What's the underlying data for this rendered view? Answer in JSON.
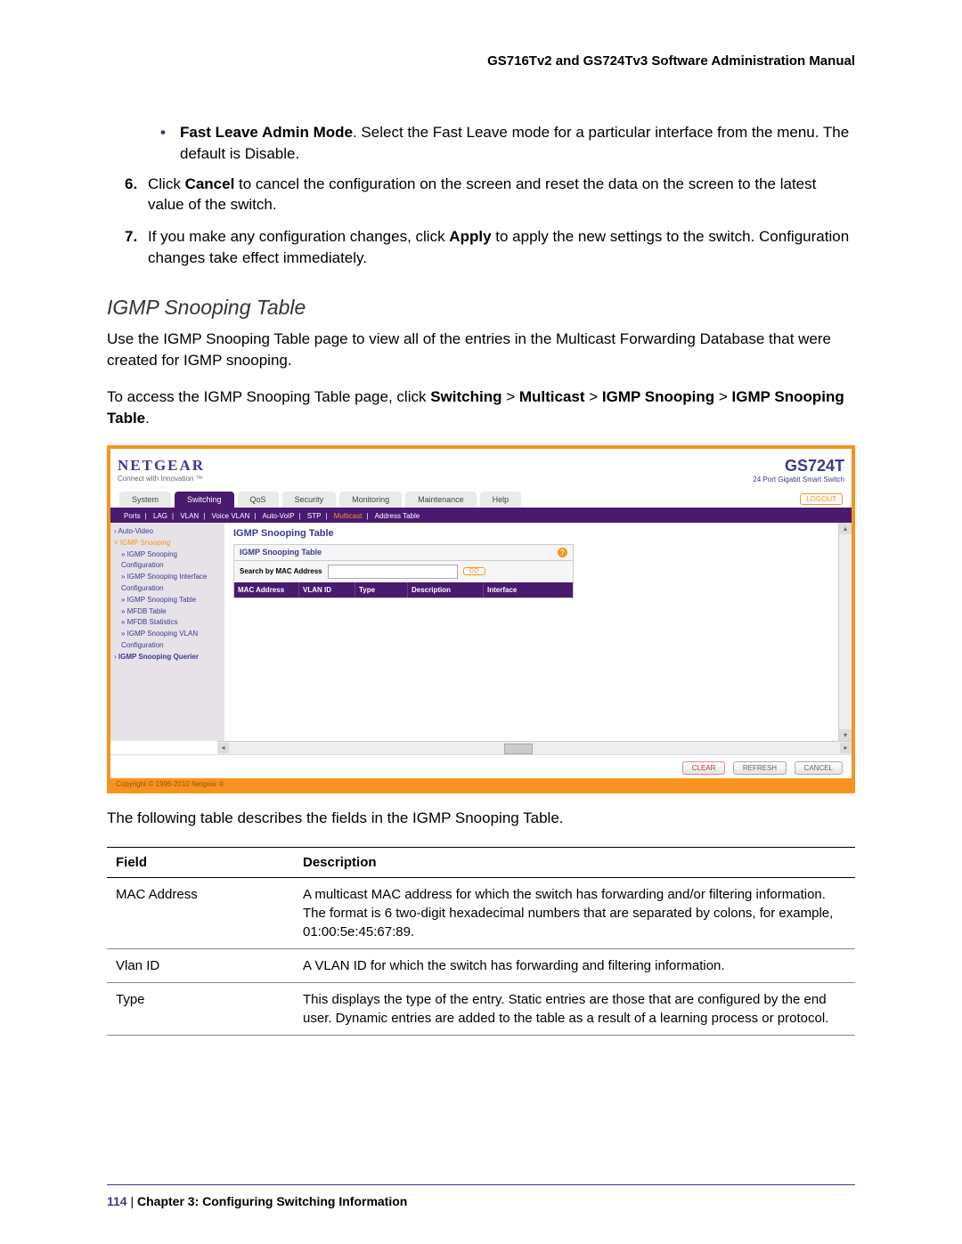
{
  "header": {
    "title": "GS716Tv2 and GS724Tv3 Software Administration Manual"
  },
  "bullet": {
    "label": "Fast Leave Admin Mode",
    "text": ". Select the Fast Leave mode for a particular interface from the menu. The default is Disable."
  },
  "step6": {
    "num": "6.",
    "pre": "Click ",
    "bold": "Cancel",
    "post": " to cancel the configuration on the screen and reset the data on the screen to the latest value of the switch."
  },
  "step7": {
    "num": "7.",
    "pre": "If you make any configuration changes, click ",
    "bold": "Apply",
    "post": " to apply the new settings to the switch. Configuration changes take effect immediately."
  },
  "section": {
    "heading": "IGMP Snooping Table"
  },
  "para1": "Use the IGMP Snooping Table page to view all of the entries in the Multicast Forwarding Database that were created for IGMP snooping.",
  "para2": {
    "pre": "To access the IGMP Snooping Table page, click ",
    "b1": "Switching",
    "g1": " > ",
    "b2": "Multicast",
    "g2": " > ",
    "b3": "IGMP Snooping",
    "g3": " > ",
    "b4": "IGMP Snooping Table",
    "post": "."
  },
  "ss": {
    "brand": "NETGEAR",
    "tagline": "Connect with Innovation ™",
    "model": "GS724T",
    "model_sub": "24 Port Gigabit Smart Switch",
    "tabs": [
      "System",
      "Switching",
      "QoS",
      "Security",
      "Monitoring",
      "Maintenance",
      "Help"
    ],
    "active_tab": 1,
    "logout": "LOGOUT",
    "subnav": [
      "Ports",
      "LAG",
      "VLAN",
      "Voice VLAN",
      "Auto-VoIP",
      "STP",
      "Multicast",
      "Address Table"
    ],
    "subnav_active": 6,
    "sidebar": {
      "items": [
        {
          "label": "Auto-Video",
          "cls": "sub arrow"
        },
        {
          "label": "IGMP Snooping",
          "cls": "hl"
        },
        {
          "label": "» IGMP Snooping Configuration",
          "cls": "sub"
        },
        {
          "label": "» IGMP Snooping Interface Configuration",
          "cls": "sub"
        },
        {
          "label": "» IGMP Snooping Table",
          "cls": "sub hl"
        },
        {
          "label": "» MFDB Table",
          "cls": "sub"
        },
        {
          "label": "» MFDB Statistics",
          "cls": "sub"
        },
        {
          "label": "» IGMP Snooping VLAN Configuration",
          "cls": "sub"
        },
        {
          "label": "IGMP Snooping Querier",
          "cls": ""
        }
      ]
    },
    "main_title": "IGMP Snooping Table",
    "panel_title": "IGMP Snooping Table",
    "search_label": "Search by MAC Address",
    "go": "GO",
    "columns": [
      "MAC Address",
      "VLAN ID",
      "Type",
      "Description",
      "Interface"
    ],
    "footer_buttons": [
      "CLEAR",
      "REFRESH",
      "CANCEL"
    ],
    "copyright": "Copyright © 1996-2010 Netgear ®"
  },
  "below": "The following table describes the fields in the IGMP Snooping Table.",
  "ftable": {
    "h1": "Field",
    "h2": "Description",
    "rows": [
      {
        "f": "MAC Address",
        "d": "A multicast MAC address for which the switch has forwarding and/or filtering information. The format is 6 two-digit hexadecimal numbers that are separated by colons, for example, 01:00:5e:45:67:89."
      },
      {
        "f": "Vlan ID",
        "d": "A VLAN ID for which the switch has forwarding and filtering information."
      },
      {
        "f": "Type",
        "d": "This displays the type of the entry. Static entries are those that are configured by the end user. Dynamic entries are added to the table as a result of a learning process or protocol."
      }
    ]
  },
  "footer": {
    "pagenum": "114",
    "sep": "   |   ",
    "chapter": "Chapter 3:  Configuring Switching Information"
  }
}
